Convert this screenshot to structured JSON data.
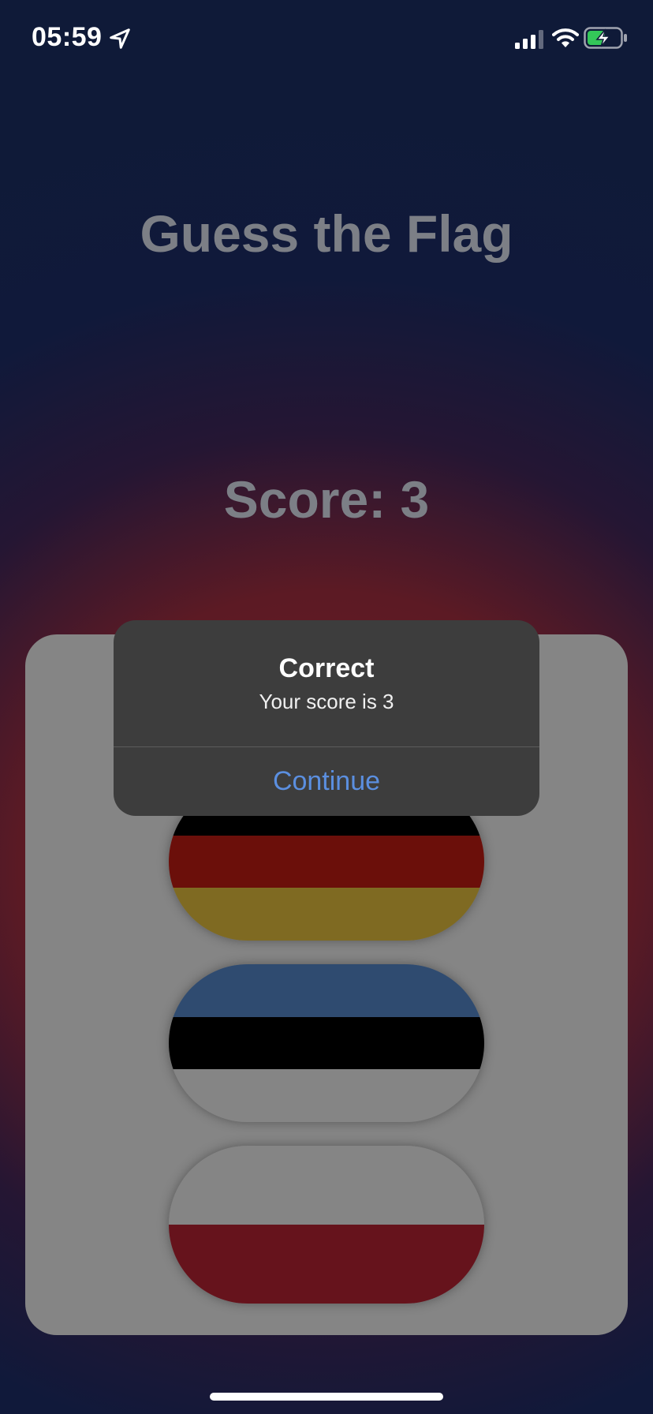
{
  "status_bar": {
    "time": "05:59",
    "icons": [
      "location-arrow-icon",
      "cellular-signal-icon",
      "wifi-icon",
      "battery-charging-icon"
    ]
  },
  "app": {
    "title": "Guess the Flag",
    "score_label": "Score: 3"
  },
  "flags": [
    {
      "stripes": [
        "#000000",
        "#6b0f0a",
        "#7f6a22"
      ]
    },
    {
      "stripes": [
        "#2f4b70",
        "#000000",
        "#858585"
      ]
    },
    {
      "stripes": [
        "#858585",
        "#66131c"
      ]
    }
  ],
  "alert": {
    "title": "Correct",
    "message": "Your score is 3",
    "button_label": "Continue"
  },
  "colors": {
    "background_top": "#0f1a38",
    "background_bottom": "#5c1a24",
    "card": "#858585",
    "alert_bg": "#3d3d3d",
    "alert_button": "#5b8fe0",
    "text_muted": "#7c7f86"
  }
}
